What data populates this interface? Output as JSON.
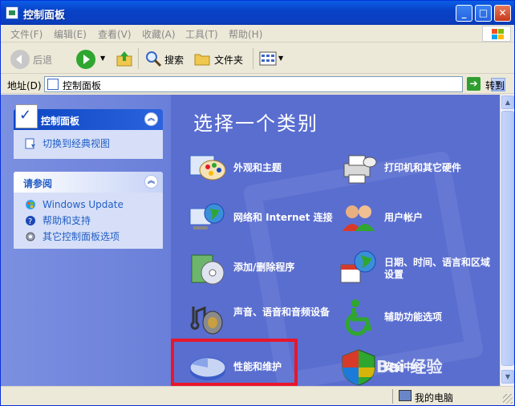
{
  "window": {
    "title": "控制面板",
    "buttons": {
      "minimize": "_",
      "maximize": "□",
      "close": "✕"
    }
  },
  "menu": [
    "文件(F)",
    "编辑(E)",
    "查看(V)",
    "收藏(A)",
    "工具(T)",
    "帮助(H)"
  ],
  "toolbar": {
    "back": "后退",
    "search": "搜索",
    "folders": "文件夹"
  },
  "address": {
    "label": "地址(D)",
    "value": "控制面板",
    "go": "转到"
  },
  "left_panel": {
    "primary": {
      "title": "控制面板",
      "links": [
        "切换到经典视图"
      ]
    },
    "see_also": {
      "title": "请参阅",
      "links": [
        "Windows Update",
        "帮助和支持",
        "其它控制面板选项"
      ]
    }
  },
  "main": {
    "title": "选择一个类别",
    "categories": [
      "外观和主题",
      "打印机和其它硬件",
      "网络和 Internet 连接",
      "用户帐户",
      "添加/删除程序",
      "日期、时间、语言和区域设置",
      "声音、语音和音频设备",
      "辅助功能选项",
      "性能和维护",
      "安全中心"
    ]
  },
  "status": {
    "text": "我的电脑"
  },
  "watermark": "Bai 经验",
  "colors": {
    "content_bg": "#5a6ed0",
    "highlight": "#e8162b",
    "title_bar": "#0842c7"
  }
}
